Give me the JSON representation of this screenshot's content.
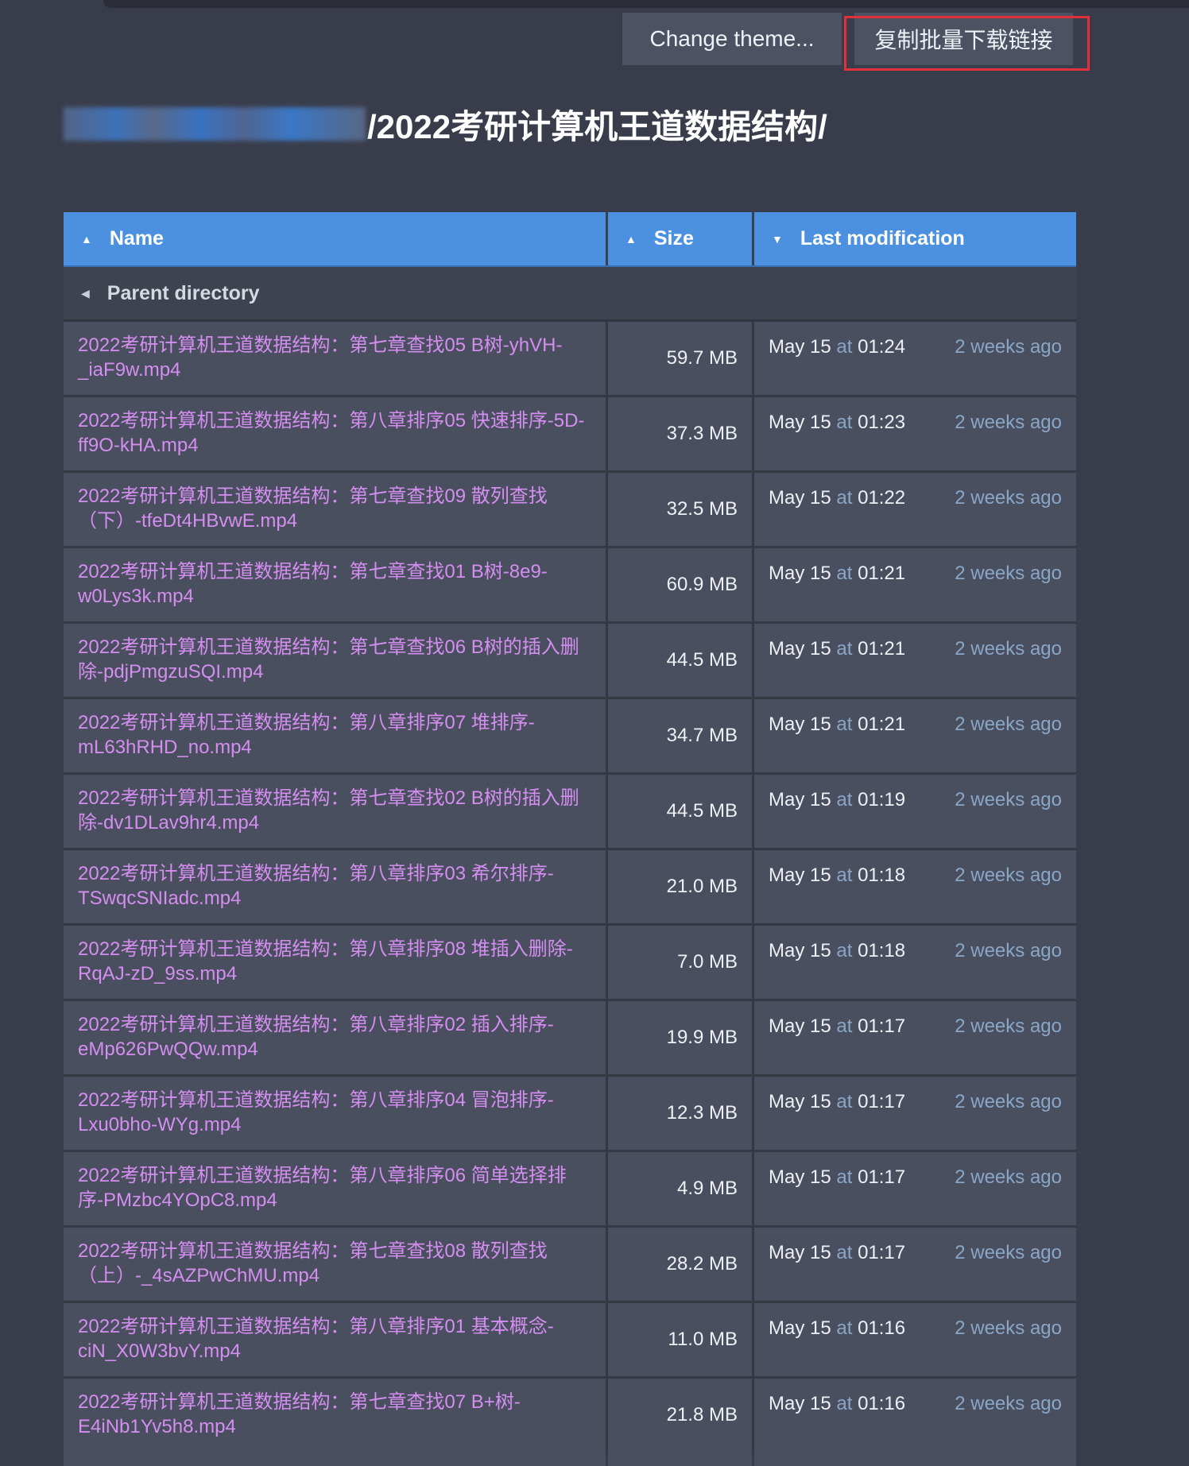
{
  "toolbar": {
    "theme_label": "Change theme...",
    "copy_label": "复制批量下载链接"
  },
  "breadcrumb": {
    "path": "/2022考研计算机王道数据结构/"
  },
  "table": {
    "headers": {
      "name": "Name",
      "size": "Size",
      "modified": "Last modification"
    },
    "parent_label": "Parent directory",
    "rows": [
      {
        "name": "2022考研计算机王道数据结构：第七章查找05 B树-yhVH-_iaF9w.mp4",
        "size": "59.7 MB",
        "date": "May 15",
        "at": "at",
        "time": "01:24",
        "ago": "2 weeks ago"
      },
      {
        "name": "2022考研计算机王道数据结构：第八章排序05 快速排序-5D-ff9O-kHA.mp4",
        "size": "37.3 MB",
        "date": "May 15",
        "at": "at",
        "time": "01:23",
        "ago": "2 weeks ago"
      },
      {
        "name": "2022考研计算机王道数据结构：第七章查找09 散列查找（下）-tfeDt4HBvwE.mp4",
        "size": "32.5 MB",
        "date": "May 15",
        "at": "at",
        "time": "01:22",
        "ago": "2 weeks ago"
      },
      {
        "name": "2022考研计算机王道数据结构：第七章查找01 B树-8e9-w0Lys3k.mp4",
        "size": "60.9 MB",
        "date": "May 15",
        "at": "at",
        "time": "01:21",
        "ago": "2 weeks ago"
      },
      {
        "name": "2022考研计算机王道数据结构：第七章查找06 B树的插入删除-pdjPmgzuSQI.mp4",
        "size": "44.5 MB",
        "date": "May 15",
        "at": "at",
        "time": "01:21",
        "ago": "2 weeks ago"
      },
      {
        "name": "2022考研计算机王道数据结构：第八章排序07 堆排序-mL63hRHD_no.mp4",
        "size": "34.7 MB",
        "date": "May 15",
        "at": "at",
        "time": "01:21",
        "ago": "2 weeks ago"
      },
      {
        "name": "2022考研计算机王道数据结构：第七章查找02 B树的插入删除-dv1DLav9hr4.mp4",
        "size": "44.5 MB",
        "date": "May 15",
        "at": "at",
        "time": "01:19",
        "ago": "2 weeks ago"
      },
      {
        "name": "2022考研计算机王道数据结构：第八章排序03 希尔排序-TSwqcSNIadc.mp4",
        "size": "21.0 MB",
        "date": "May 15",
        "at": "at",
        "time": "01:18",
        "ago": "2 weeks ago"
      },
      {
        "name": "2022考研计算机王道数据结构：第八章排序08 堆插入删除-RqAJ-zD_9ss.mp4",
        "size": "7.0 MB",
        "date": "May 15",
        "at": "at",
        "time": "01:18",
        "ago": "2 weeks ago"
      },
      {
        "name": "2022考研计算机王道数据结构：第八章排序02 插入排序-eMp626PwQQw.mp4",
        "size": "19.9 MB",
        "date": "May 15",
        "at": "at",
        "time": "01:17",
        "ago": "2 weeks ago"
      },
      {
        "name": "2022考研计算机王道数据结构：第八章排序04 冒泡排序-Lxu0bho-WYg.mp4",
        "size": "12.3 MB",
        "date": "May 15",
        "at": "at",
        "time": "01:17",
        "ago": "2 weeks ago"
      },
      {
        "name": "2022考研计算机王道数据结构：第八章排序06 简单选择排序-PMzbc4YOpC8.mp4",
        "size": "4.9 MB",
        "date": "May 15",
        "at": "at",
        "time": "01:17",
        "ago": "2 weeks ago"
      },
      {
        "name": "2022考研计算机王道数据结构：第七章查找08 散列查找（上）-_4sAZPwChMU.mp4",
        "size": "28.2 MB",
        "date": "May 15",
        "at": "at",
        "time": "01:17",
        "ago": "2 weeks ago"
      },
      {
        "name": "2022考研计算机王道数据结构：第八章排序01 基本概念-ciN_X0W3bvY.mp4",
        "size": "11.0 MB",
        "date": "May 15",
        "at": "at",
        "time": "01:16",
        "ago": "2 weeks ago"
      },
      {
        "name": "2022考研计算机王道数据结构：第七章查找07 B+树-E4iNb1Yv5h8.mp4",
        "size": "21.8 MB",
        "date": "May 15",
        "at": "at",
        "time": "01:16",
        "ago": "2 weeks ago"
      }
    ]
  }
}
